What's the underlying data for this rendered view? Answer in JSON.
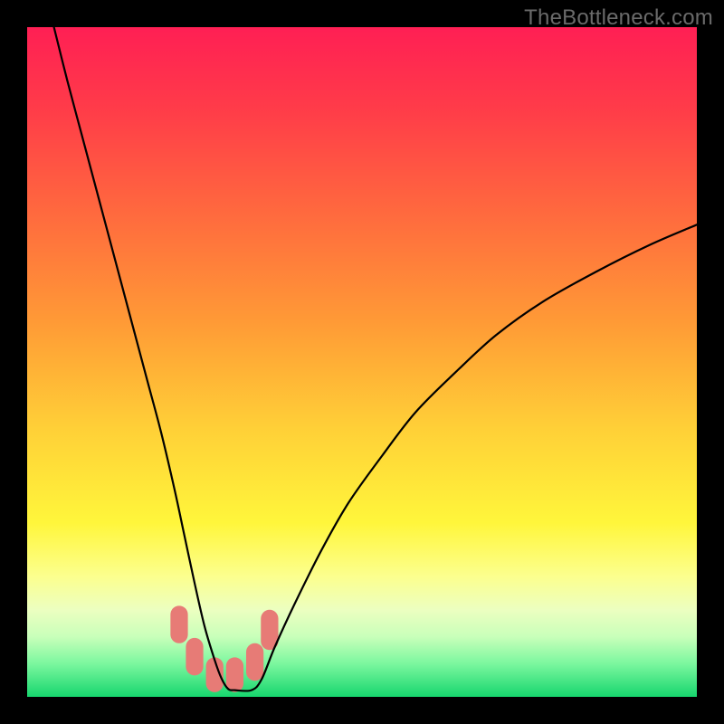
{
  "watermark": "TheBottleneck.com",
  "chart_data": {
    "type": "line",
    "title": "",
    "xlabel": "",
    "ylabel": "",
    "xlim": [
      0,
      100
    ],
    "ylim": [
      0,
      100
    ],
    "gradient_stops": [
      {
        "offset": 0.0,
        "color": "#ff1f54"
      },
      {
        "offset": 0.12,
        "color": "#ff3b49"
      },
      {
        "offset": 0.28,
        "color": "#ff6a3e"
      },
      {
        "offset": 0.44,
        "color": "#ff9a36"
      },
      {
        "offset": 0.6,
        "color": "#ffd037"
      },
      {
        "offset": 0.74,
        "color": "#fff63b"
      },
      {
        "offset": 0.82,
        "color": "#fcff8e"
      },
      {
        "offset": 0.87,
        "color": "#ecffc0"
      },
      {
        "offset": 0.91,
        "color": "#c9ffba"
      },
      {
        "offset": 0.95,
        "color": "#7cf79f"
      },
      {
        "offset": 1.0,
        "color": "#17d66e"
      }
    ],
    "series": [
      {
        "name": "bottleneck-curve",
        "x": [
          4,
          6,
          8,
          10,
          12,
          14,
          16,
          18,
          20,
          22,
          23.5,
          25,
          26.5,
          28,
          29,
          30,
          31,
          33.5,
          35,
          37,
          40,
          44,
          48,
          53,
          58,
          64,
          70,
          77,
          85,
          93,
          100
        ],
        "y": [
          100,
          92,
          84.5,
          77,
          69.5,
          62,
          54.5,
          47,
          39.5,
          31,
          24,
          17,
          10.5,
          5.5,
          2.8,
          1.2,
          1.0,
          1.0,
          2.6,
          7.5,
          14,
          22,
          29,
          36,
          42.5,
          48.5,
          54,
          59,
          63.5,
          67.5,
          70.5
        ]
      }
    ],
    "pink_band": {
      "segments": [
        {
          "x": 22.7,
          "y": 8.0,
          "w": 2.6,
          "h": 5.6
        },
        {
          "x": 25.0,
          "y": 3.2,
          "w": 2.6,
          "h": 5.6
        },
        {
          "x": 28.0,
          "y": 0.7,
          "w": 2.6,
          "h": 5.2
        },
        {
          "x": 31.0,
          "y": 0.7,
          "w": 2.6,
          "h": 5.2
        },
        {
          "x": 34.0,
          "y": 2.4,
          "w": 2.6,
          "h": 5.6
        },
        {
          "x": 36.2,
          "y": 7.0,
          "w": 2.6,
          "h": 6.0
        }
      ],
      "color": "#e77b76"
    }
  }
}
